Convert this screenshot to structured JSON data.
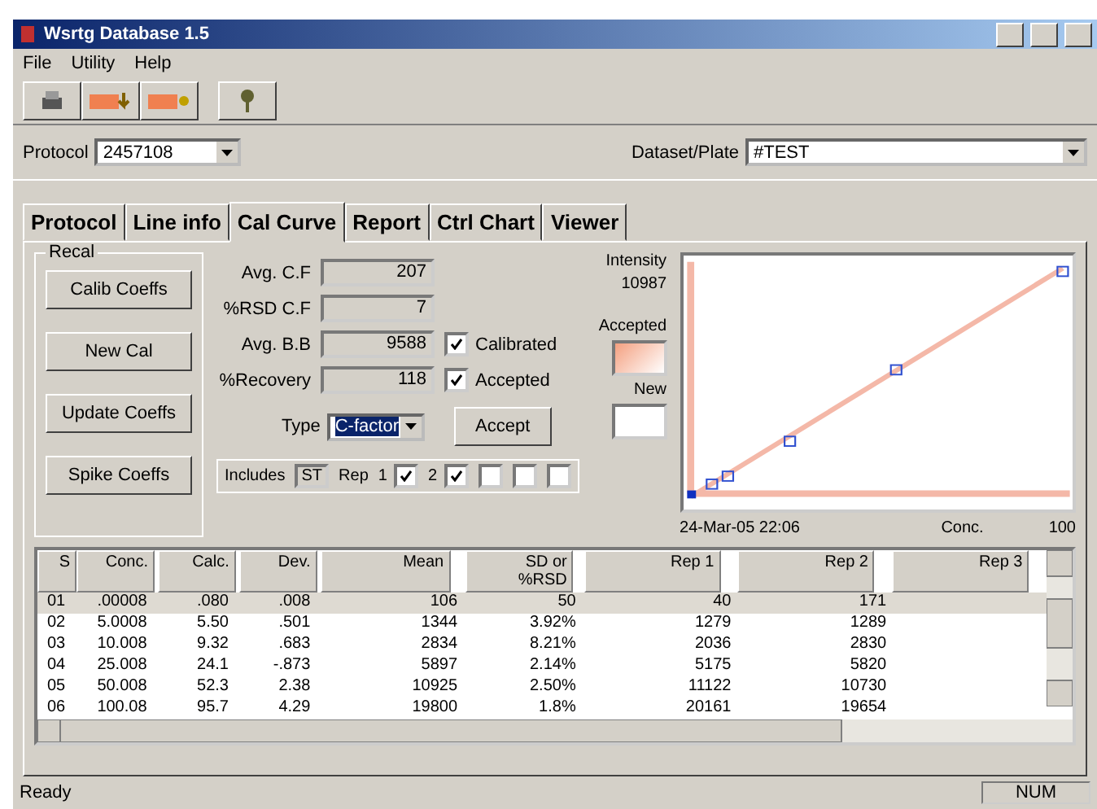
{
  "window": {
    "title": "Wsrtg Database 1.5"
  },
  "menu": [
    "File",
    "Utility",
    "Help"
  ],
  "protocol": {
    "label": "Protocol",
    "value": "2457108"
  },
  "dataset": {
    "label": "Dataset/Plate",
    "value": "#TEST"
  },
  "tabs": [
    {
      "label": "Protocol",
      "selected": false
    },
    {
      "label": "Line info",
      "selected": false
    },
    {
      "label": "Cal Curve",
      "selected": true
    },
    {
      "label": "Report",
      "selected": false
    },
    {
      "label": "Ctrl Chart",
      "selected": false
    },
    {
      "label": "Viewer",
      "selected": false
    }
  ],
  "recal": {
    "title": "Recal",
    "buttons": [
      "Calib Coeffs",
      "New Cal",
      "Update Coeffs",
      "Spike Coeffs"
    ]
  },
  "fields": [
    {
      "label": "Avg. C.F",
      "value": "207"
    },
    {
      "label": "%RSD C.F",
      "value": "7"
    },
    {
      "label": "Avg. B.B",
      "value": "9588"
    },
    {
      "label": "%Recovery",
      "value": "118"
    }
  ],
  "checks": [
    {
      "label": "Calibrated",
      "checked": true
    },
    {
      "label": "Accepted",
      "checked": true
    }
  ],
  "type": {
    "label": "Type",
    "value": "C-factor"
  },
  "accept_button": "Accept",
  "includes": {
    "label": "Includes",
    "st": "ST",
    "rep_label": "Rep",
    "reps": [
      {
        "label": "1",
        "checked": true
      },
      {
        "label": "2",
        "checked": true
      },
      {
        "checked": false
      },
      {
        "checked": false
      },
      {
        "checked": false
      }
    ]
  },
  "side": {
    "intensity_label": "Intensity",
    "intensity": "10987",
    "accepted_label": "Accepted",
    "new_label": "New"
  },
  "chart": {
    "date": "24-Mar-05 22:06",
    "xlabel": "Conc.",
    "xmax": "100"
  },
  "table": {
    "columns": [
      "S",
      "Conc.",
      "Calc.",
      "Dev.",
      "Mean",
      "SD or %RSD",
      "Rep 1",
      "Rep 2",
      "Rep 3"
    ],
    "rows": [
      {
        "selected": true,
        "cells": [
          "01",
          ".00008",
          ".080",
          ".008",
          "106",
          "50",
          "40",
          "171"
        ]
      },
      {
        "selected": false,
        "cells": [
          "02",
          "5.0008",
          "5.50",
          ".501",
          "1344",
          "3.92%",
          "1279",
          "1289"
        ]
      },
      {
        "selected": false,
        "cells": [
          "03",
          "10.008",
          "9.32",
          ".683",
          "2834",
          "8.21%",
          "2036",
          "2830"
        ]
      },
      {
        "selected": false,
        "cells": [
          "04",
          "25.008",
          "24.1",
          "-.873",
          "5897",
          "2.14%",
          "5175",
          "5820"
        ]
      },
      {
        "selected": false,
        "cells": [
          "05",
          "50.008",
          "52.3",
          "2.38",
          "10925",
          "2.50%",
          "11122",
          "10730"
        ]
      },
      {
        "selected": false,
        "cells": [
          "06",
          "100.08",
          "95.7",
          "4.29",
          "19800",
          "1.8%",
          "20161",
          "19654"
        ]
      }
    ]
  },
  "status": {
    "text": "Ready",
    "num": "NUM"
  }
}
